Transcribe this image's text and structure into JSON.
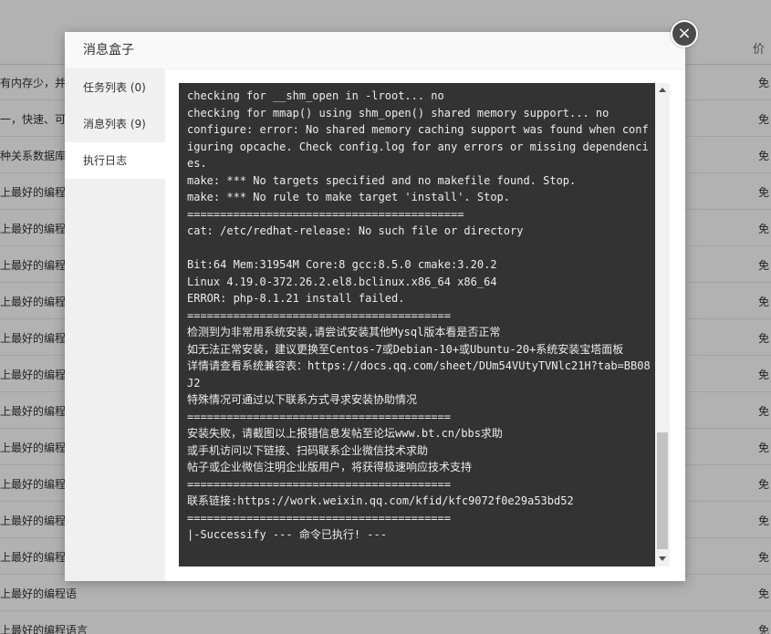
{
  "background": {
    "header_right": "价",
    "rows": [
      {
        "left": "有内存少，并发",
        "right": "免"
      },
      {
        "left": "一，快速、可靠",
        "right": "免"
      },
      {
        "left": "种关系数据库",
        "right": "免"
      },
      {
        "left": "上最好的编程语",
        "right": "免"
      },
      {
        "left": "上最好的编程语",
        "right": "免"
      },
      {
        "left": "上最好的编程语",
        "right": "免"
      },
      {
        "left": "上最好的编程语",
        "right": "免"
      },
      {
        "left": "上最好的编程语",
        "right": "免"
      },
      {
        "left": "上最好的编程语",
        "right": "免"
      },
      {
        "left": "上最好的编程语",
        "right": "免"
      },
      {
        "left": "上最好的编程语",
        "right": "免"
      },
      {
        "left": "上最好的编程语",
        "right": "免"
      },
      {
        "left": "上最好的编程语",
        "right": "免"
      },
      {
        "left": "上最好的编程语",
        "right": "免"
      },
      {
        "left": "上最好的编程语",
        "right": "免"
      },
      {
        "left": "上最好的编程语言",
        "right": "免"
      }
    ]
  },
  "modal": {
    "title": "消息盒子",
    "close_label": "×",
    "tabs": [
      {
        "label": "任务列表 (0)"
      },
      {
        "label": "消息列表 (9)"
      },
      {
        "label": "执行日志"
      }
    ],
    "log": "checking for __shm_open in -lroot... no\nchecking for mmap() using shm_open() shared memory support... no\nconfigure: error: No shared memory caching support was found when configuring opcache. Check config.log for any errors or missing dependencies.\nmake: *** No targets specified and no makefile found. Stop.\nmake: *** No rule to make target 'install'. Stop.\n==========================================\ncat: /etc/redhat-release: No such file or directory\n\nBit:64 Mem:31954M Core:8 gcc:8.5.0 cmake:3.20.2\nLinux 4.19.0-372.26.2.el8.bclinux.x86_64 x86_64\nERROR: php-8.1.21 install failed.\n========================================\n检测到为非常用系统安装,请尝试安装其他Mysql版本看是否正常\n如无法正常安装，建议更换至Centos-7或Debian-10+或Ubuntu-20+系统安装宝塔面板\n详情请查看系统兼容表：https://docs.qq.com/sheet/DUm54VUtyTVNlc21H?tab=BB08J2\n特殊情况可通过以下联系方式寻求安装协助情况\n========================================\n安装失败，请截图以上报错信息发帖至论坛www.bt.cn/bbs求助\n或手机访问以下链接、扫码联系企业微信技术求助\n帖子或企业微信注明企业版用户，将获得极速响应技术支持\n========================================\n联系链接:https://work.weixin.qq.com/kfid/kfc9072f0e29a53bd52\n========================================\n|-Successify --- 命令已执行! ---"
  }
}
